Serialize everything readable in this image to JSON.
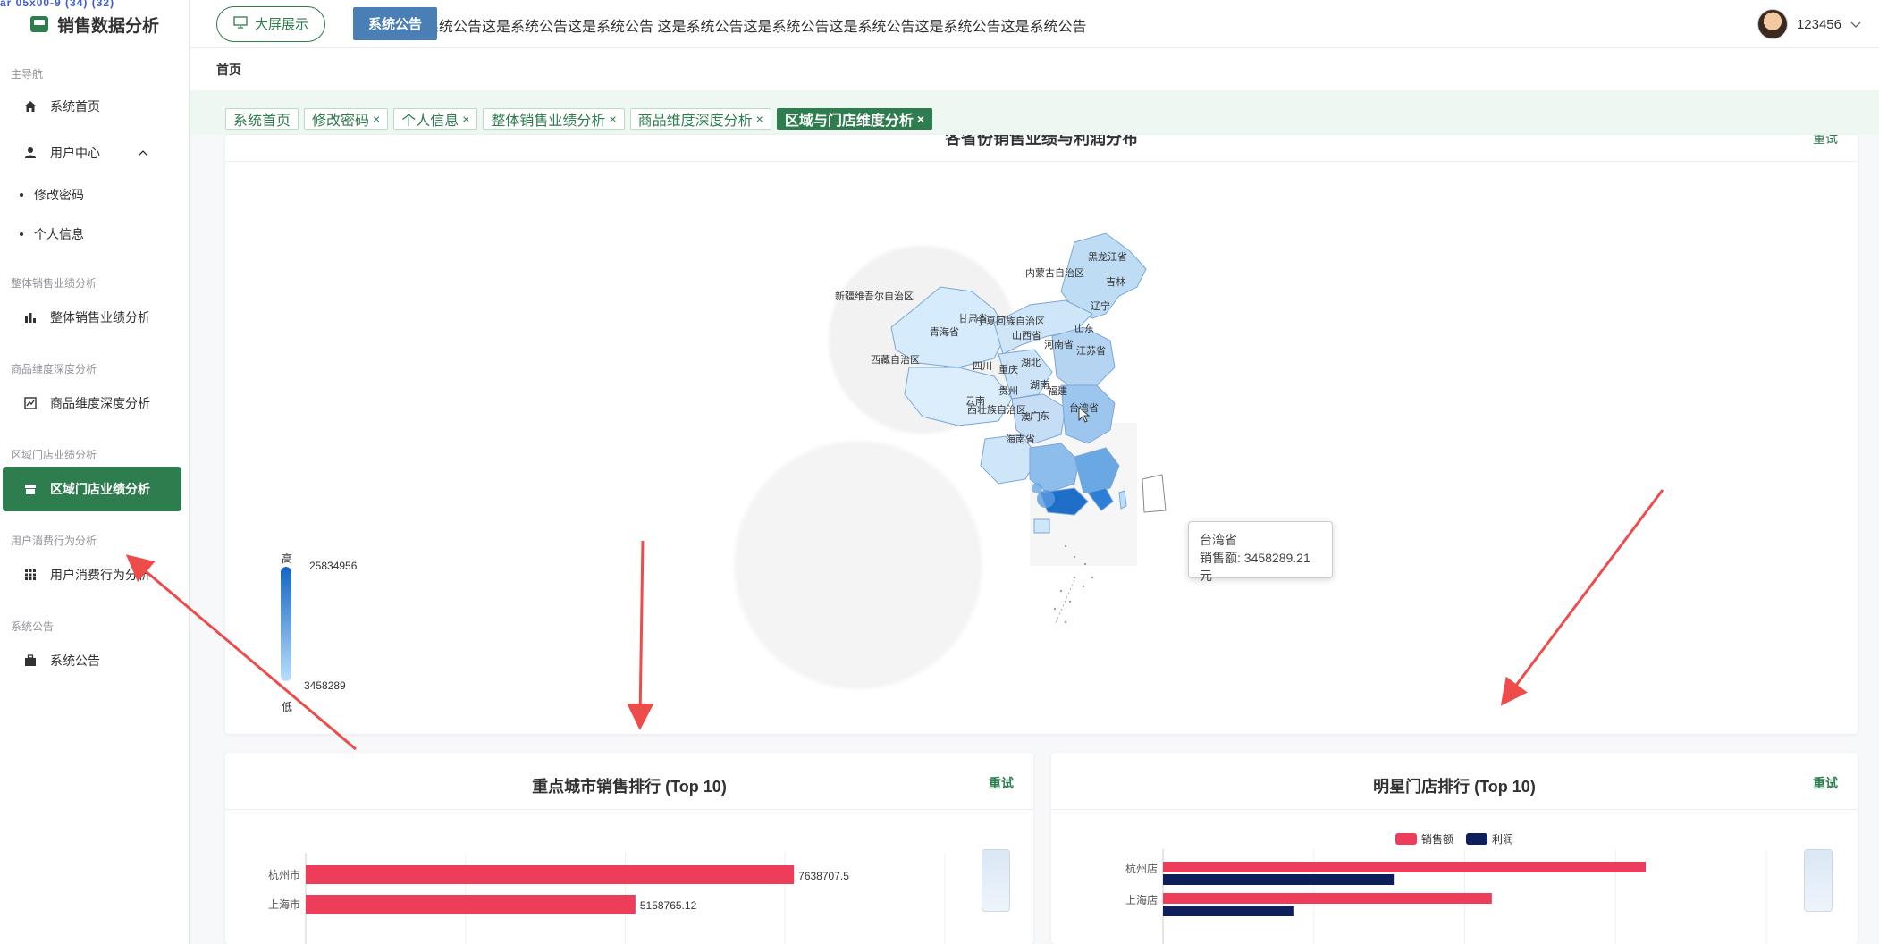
{
  "app": {
    "title": "销售数据分析",
    "overlay_text": "ar 05x00-9 (34) (32)"
  },
  "header": {
    "big_screen_label": "大屏展示",
    "notice_label": "系统公告",
    "marquee": "统公告这是系统公告这是系统公告这是系统公告        这是系统公告这是系统公告这是系统公告这是系统公告这是系统公告",
    "user_name": "123456"
  },
  "breadcrumb": "首页",
  "sidebar": {
    "groups": [
      {
        "label": "主导航"
      },
      {
        "label": "整体销售业绩分析"
      },
      {
        "label": "商品维度深度分析"
      },
      {
        "label": "区域门店业绩分析"
      },
      {
        "label": "用户消费行为分析"
      },
      {
        "label": "系统公告"
      }
    ],
    "items": {
      "home": "系统首页",
      "user_center": "用户中心",
      "change_password": "修改密码",
      "personal_info": "个人信息",
      "overall_sales": "整体销售业绩分析",
      "product_analysis": "商品维度深度分析",
      "region_store": "区域门店业绩分析",
      "user_behavior": "用户消费行为分析",
      "system_notice": "系统公告"
    }
  },
  "tabs": [
    {
      "label": "系统首页",
      "closable": false
    },
    {
      "label": "修改密码",
      "closable": true
    },
    {
      "label": "个人信息",
      "closable": true
    },
    {
      "label": "整体销售业绩分析",
      "closable": true
    },
    {
      "label": "商品维度深度分析",
      "closable": true
    },
    {
      "label": "区域与门店维度分析",
      "closable": true,
      "active": true
    }
  ],
  "close_glyph": "×",
  "map_card": {
    "title": "各省份销售业绩与利润分布",
    "retry": "重试",
    "visual_map": {
      "high": "高",
      "low": "低",
      "max": "25834956",
      "min": "3458289"
    },
    "tooltip": {
      "province": "台湾省",
      "line": "销售额: 3458289.21元"
    },
    "province_labels": [
      "黑龙江省",
      "吉林",
      "内蒙古自治区",
      "辽宁",
      "新疆维吾尔自治区",
      "甘肃省",
      "宁夏回族自治区",
      "山西省",
      "山东",
      "青海省",
      "河南省",
      "江苏省",
      "西藏自治区",
      "四川",
      "湖北",
      "重庆",
      "湖南",
      "云南",
      "贵州",
      "西壮族自治区",
      "广东",
      "福建",
      "台湾省",
      "海南省",
      "澳门"
    ]
  },
  "city_card": {
    "title": "重点城市销售排行 (Top 10)",
    "retry": "重试"
  },
  "store_card": {
    "title": "明星门店排行 (Top 10)",
    "retry": "重试",
    "legend": [
      "销售额",
      "利润"
    ]
  },
  "chart_data": [
    {
      "type": "bar",
      "title": "重点城市销售排行 (Top 10)",
      "orientation": "horizontal",
      "categories": [
        "杭州市",
        "上海市"
      ],
      "values": [
        7638707.5,
        5158765.12
      ],
      "value_labels": [
        "7638707.5",
        "5158765.12"
      ],
      "xlim": [
        0,
        10000000
      ],
      "color": "#ee3d5a"
    },
    {
      "type": "bar",
      "title": "明星门店排行 (Top 10)",
      "orientation": "horizontal",
      "categories": [
        "杭州店",
        "上海店"
      ],
      "series": [
        {
          "name": "销售额",
          "values": [
            6400000,
            4360000
          ],
          "color": "#ee3d5a"
        },
        {
          "name": "利润",
          "values": [
            3060000,
            1740000
          ],
          "color": "#0f1f5c"
        }
      ],
      "xlim": [
        0,
        8000000
      ],
      "legend": "top-center"
    }
  ]
}
